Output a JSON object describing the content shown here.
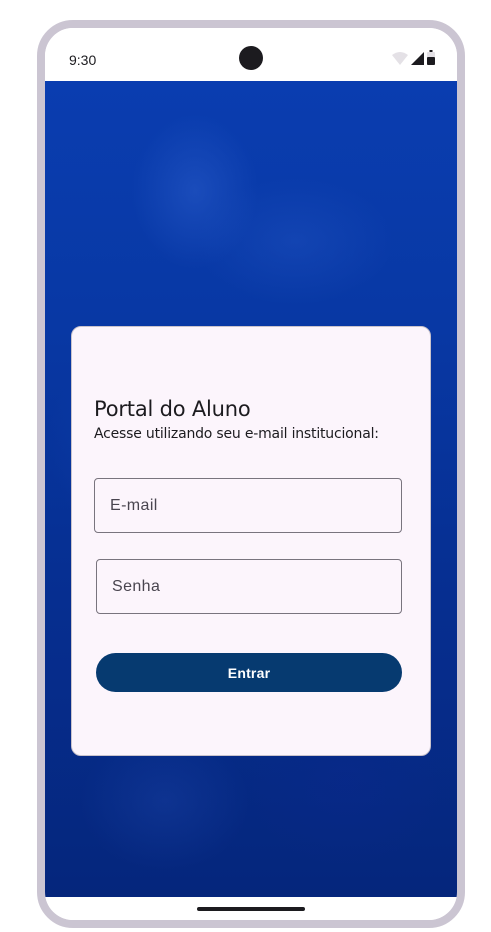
{
  "status_bar": {
    "time": "9:30",
    "icons": [
      "wifi-icon",
      "signal-icon",
      "battery-icon"
    ]
  },
  "login_card": {
    "title": "Portal do Aluno",
    "subtitle": "Acesse utilizando seu e-mail institucional:",
    "email": {
      "placeholder": "E-mail",
      "value": ""
    },
    "password": {
      "placeholder": "Senha",
      "value": ""
    },
    "submit_label": "Entrar"
  },
  "colors": {
    "background_blue": "#0838a4",
    "card_background": "#fcf5fc",
    "button_primary": "#063a70",
    "device_frame": "#cbc5d2"
  }
}
